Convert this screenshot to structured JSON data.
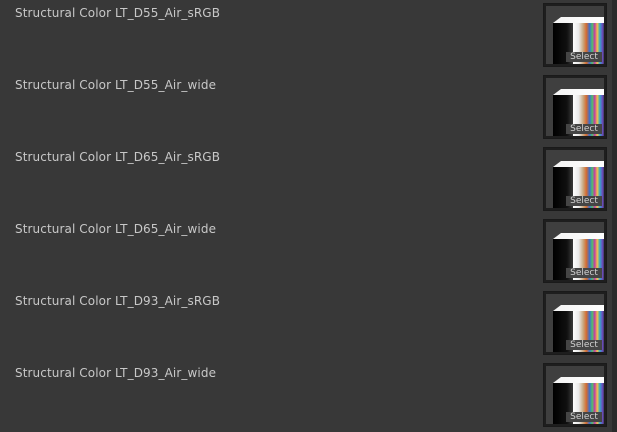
{
  "textures": [
    {
      "label": "Structural Color LT_D55_Air_sRGB",
      "button": "Select"
    },
    {
      "label": "Structural Color LT_D55_Air_wide",
      "button": "Select"
    },
    {
      "label": "Structural Color LT_D65_Air_sRGB",
      "button": "Select"
    },
    {
      "label": "Structural Color LT_D65_Air_wide",
      "button": "Select"
    },
    {
      "label": "Structural Color LT_D93_Air_sRGB",
      "button": "Select"
    },
    {
      "label": "Structural Color LT_D93_Air_wide",
      "button": "Select"
    }
  ],
  "colors": {
    "background": "#383838",
    "label_text": "#c8c8c8",
    "slot_border": "#1e1e1e"
  }
}
